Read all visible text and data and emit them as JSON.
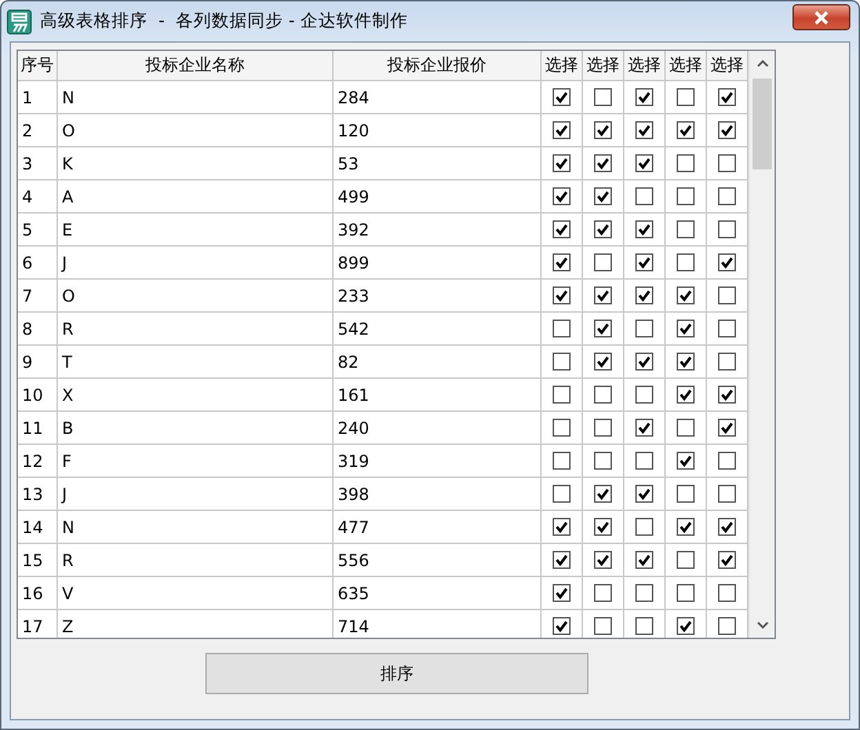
{
  "window": {
    "title": "高级表格排序  -  各列数据同步 - 企达软件制作"
  },
  "table": {
    "columns": [
      "序号",
      "投标企业名称",
      "投标企业报价",
      "选择",
      "选择",
      "选择",
      "选择",
      "选择"
    ],
    "rows": [
      {
        "index": "1",
        "name": "N",
        "price": "284",
        "checks": [
          {
            "checked": true
          },
          {
            "checked": false
          },
          {
            "checked": true
          },
          {
            "checked": false
          },
          {
            "checked": true
          }
        ]
      },
      {
        "index": "2",
        "name": "O",
        "price": "120",
        "checks": [
          {
            "checked": true
          },
          {
            "checked": true
          },
          {
            "checked": true
          },
          {
            "checked": true
          },
          {
            "checked": true
          }
        ]
      },
      {
        "index": "3",
        "name": "K",
        "price": "53",
        "checks": [
          {
            "checked": true
          },
          {
            "checked": true
          },
          {
            "checked": true
          },
          {
            "checked": false
          },
          {
            "checked": false
          }
        ]
      },
      {
        "index": "4",
        "name": "A",
        "price": "499",
        "checks": [
          {
            "checked": true
          },
          {
            "checked": true
          },
          {
            "checked": false
          },
          {
            "checked": false
          },
          {
            "checked": false
          }
        ]
      },
      {
        "index": "5",
        "name": "E",
        "price": "392",
        "checks": [
          {
            "checked": true
          },
          {
            "checked": true
          },
          {
            "checked": true
          },
          {
            "checked": false
          },
          {
            "checked": false
          }
        ]
      },
      {
        "index": "6",
        "name": "J",
        "price": "899",
        "checks": [
          {
            "checked": true
          },
          {
            "checked": false
          },
          {
            "checked": true
          },
          {
            "checked": false
          },
          {
            "checked": true
          }
        ]
      },
      {
        "index": "7",
        "name": "O",
        "price": "233",
        "checks": [
          {
            "checked": true
          },
          {
            "checked": true
          },
          {
            "checked": true
          },
          {
            "checked": true
          },
          {
            "checked": false
          }
        ]
      },
      {
        "index": "8",
        "name": "R",
        "price": "542",
        "checks": [
          {
            "checked": false
          },
          {
            "checked": true
          },
          {
            "checked": false
          },
          {
            "checked": true
          },
          {
            "checked": false
          }
        ]
      },
      {
        "index": "9",
        "name": "T",
        "price": "82",
        "checks": [
          {
            "checked": false
          },
          {
            "checked": true
          },
          {
            "checked": true
          },
          {
            "checked": true
          },
          {
            "checked": false
          }
        ]
      },
      {
        "index": "10",
        "name": "X",
        "price": "161",
        "checks": [
          {
            "checked": false
          },
          {
            "checked": false
          },
          {
            "checked": false
          },
          {
            "checked": true
          },
          {
            "checked": true
          }
        ]
      },
      {
        "index": "11",
        "name": "B",
        "price": "240",
        "checks": [
          {
            "checked": false
          },
          {
            "checked": false
          },
          {
            "checked": true
          },
          {
            "checked": false
          },
          {
            "checked": true
          }
        ]
      },
      {
        "index": "12",
        "name": "F",
        "price": "319",
        "checks": [
          {
            "checked": false
          },
          {
            "checked": false
          },
          {
            "checked": false
          },
          {
            "checked": true
          },
          {
            "checked": false
          }
        ]
      },
      {
        "index": "13",
        "name": "J",
        "price": "398",
        "checks": [
          {
            "checked": false
          },
          {
            "checked": true
          },
          {
            "checked": true
          },
          {
            "checked": false
          },
          {
            "checked": false
          }
        ]
      },
      {
        "index": "14",
        "name": "N",
        "price": "477",
        "checks": [
          {
            "checked": true
          },
          {
            "checked": true
          },
          {
            "checked": false
          },
          {
            "checked": true
          },
          {
            "checked": true
          }
        ]
      },
      {
        "index": "15",
        "name": "R",
        "price": "556",
        "checks": [
          {
            "checked": true
          },
          {
            "checked": true
          },
          {
            "checked": true
          },
          {
            "checked": false
          },
          {
            "checked": true
          }
        ]
      },
      {
        "index": "16",
        "name": "V",
        "price": "635",
        "checks": [
          {
            "checked": true
          },
          {
            "checked": false
          },
          {
            "checked": false
          },
          {
            "checked": false
          },
          {
            "checked": false
          }
        ]
      },
      {
        "index": "17",
        "name": "Z",
        "price": "714",
        "checks": [
          {
            "checked": true
          },
          {
            "checked": false
          },
          {
            "checked": false
          },
          {
            "checked": true
          },
          {
            "checked": false
          }
        ]
      }
    ]
  },
  "buttons": [
    "排序"
  ]
}
